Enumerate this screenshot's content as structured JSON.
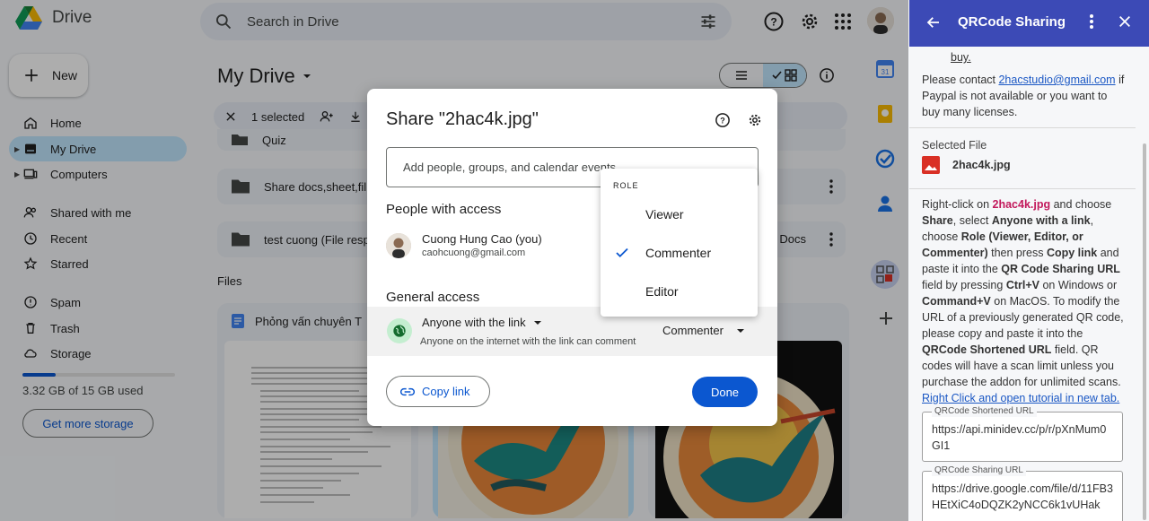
{
  "drive": {
    "app_name": "Drive",
    "search_placeholder": "Search in Drive",
    "new_label": "New",
    "nav": [
      {
        "label": "Home"
      },
      {
        "label": "My Drive"
      },
      {
        "label": "Computers"
      },
      {
        "label": "Shared with me"
      },
      {
        "label": "Recent"
      },
      {
        "label": "Starred"
      },
      {
        "label": "Spam"
      },
      {
        "label": "Trash"
      },
      {
        "label": "Storage"
      }
    ],
    "storage_used_fraction": 0.22,
    "storage_text": "3.32 GB of 15 GB used",
    "get_storage_label": "Get more storage",
    "title": "My Drive",
    "selection_text": "1 selected",
    "rows": [
      {
        "name": "Quiz"
      },
      {
        "name": "Share docs,sheet,fil"
      },
      {
        "name": "test cuong (File resp",
        "suffix": "Docs"
      }
    ],
    "files_label": "Files",
    "file_cards": [
      {
        "name": "Phỏng vấn chuyên T"
      }
    ]
  },
  "dialog": {
    "title": "Share \"2hac4k.jpg\"",
    "input_placeholder": "Add people, groups, and calendar events",
    "people_heading": "People with access",
    "person_name": "Cuong Hung Cao (you)",
    "person_email": "caohcuong@gmail.com",
    "general_heading": "General access",
    "access_who": "Anyone with the link",
    "access_desc": "Anyone on the internet with the link can comment",
    "access_role": "Commenter",
    "copy_link_label": "Copy link",
    "done_label": "Done"
  },
  "role_menu": {
    "heading": "ROLE",
    "items": [
      {
        "label": "Viewer",
        "selected": false
      },
      {
        "label": "Commenter",
        "selected": true
      },
      {
        "label": "Editor",
        "selected": false
      }
    ]
  },
  "panel": {
    "title": "QRCode Sharing",
    "buy_link": "buy.",
    "contact_prefix": "Please contact ",
    "contact_email": "2hacstudio@gmail.com",
    "contact_suffix": "if Paypal is not available or you want to buy many licenses.",
    "selected_file_label": "Selected File",
    "selected_file_name": "2hac4k.jpg",
    "instr": {
      "t1": "Right-click on ",
      "file": "2hac4k.jpg",
      "t2": " and choose ",
      "share": "Share",
      "t3": ", select ",
      "anyone": "Anyone with a link",
      "t4": ", choose ",
      "role": "Role (Viewer, Editor, or Commenter)",
      "t5": " then press ",
      "copy": "Copy link",
      "t6": " and paste it into the ",
      "qr_url_field": "QR Code Sharing URL",
      "t7": " field by pressing ",
      "ctrlv": "Ctrl+V",
      "t8": " on Windows or ",
      "cmdv": "Command+V",
      "t9": " on MacOS. To modify the URL of a previously generated QR code, please copy and paste it into the ",
      "short_field": "QRCode Shortened URL",
      "t10": " field. QR codes will have a scan limit unless you purchase the addon for unlimited scans."
    },
    "tutorial_link": "Right Click and open tutorial in new tab.",
    "shortened_label": "QRCode Shortened URL",
    "shortened_value": "https://api.minidev.cc/p/r/pXnMum0GI1",
    "sharing_label": "QRCode Sharing URL",
    "sharing_value": "https://drive.google.com/file/d/11FB3HEtXiC4oDQZK2yNCC6k1vUHak"
  }
}
